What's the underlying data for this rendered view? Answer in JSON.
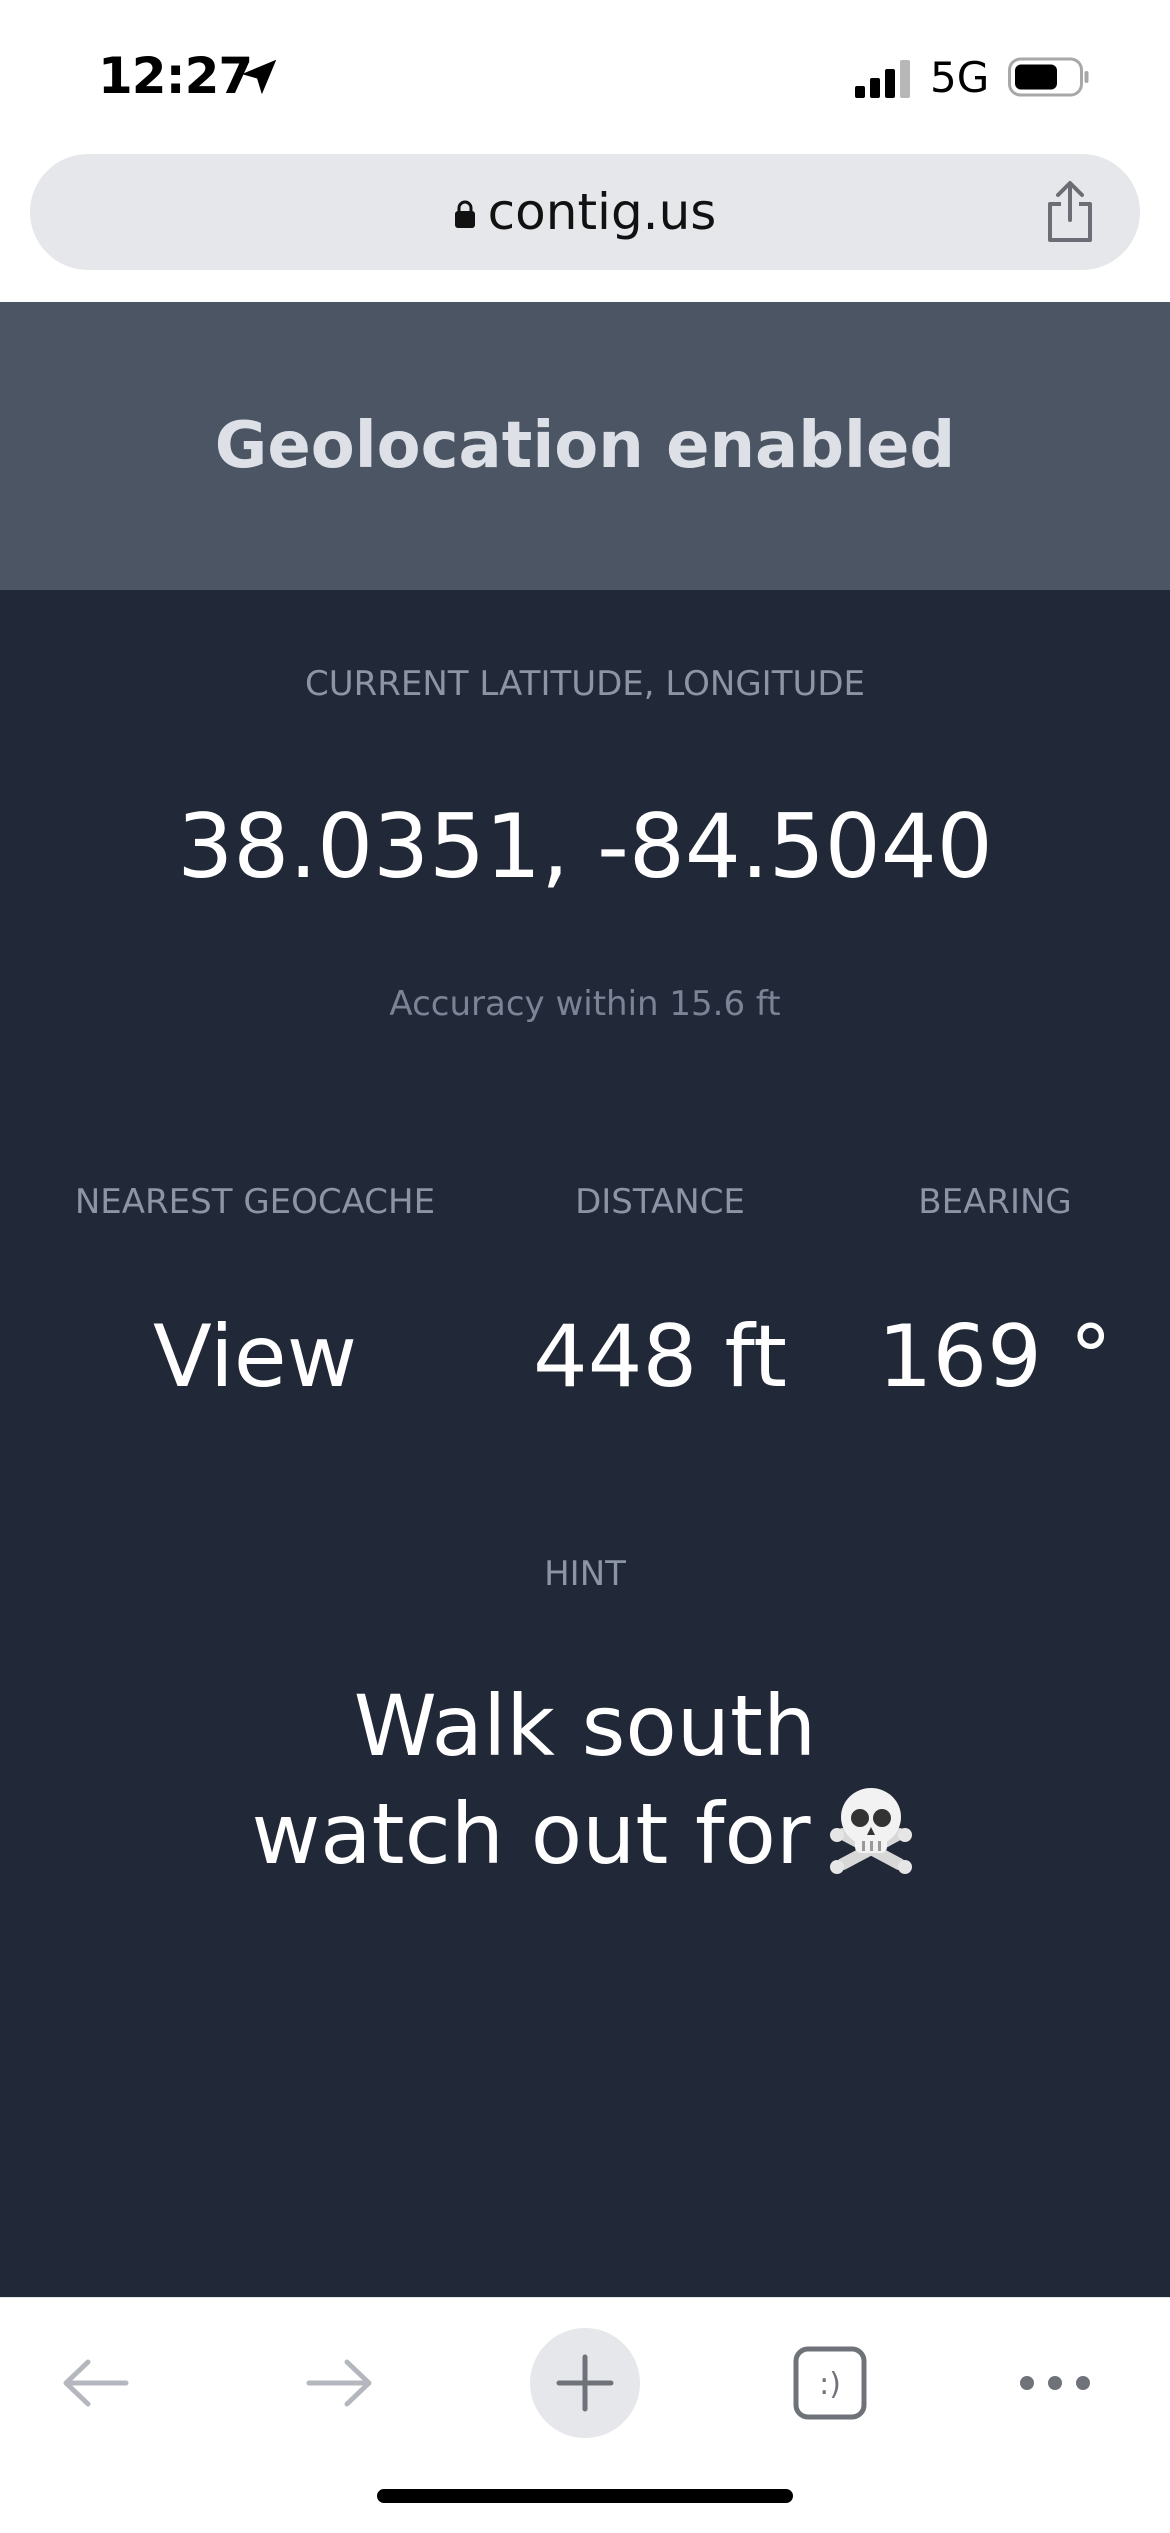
{
  "status_bar": {
    "time": "12:27",
    "network": "5G"
  },
  "browser": {
    "url": "contig.us"
  },
  "banner": {
    "text": "Geolocation enabled"
  },
  "location": {
    "label": "CURRENT LATITUDE, LONGITUDE",
    "coordinates": "38.0351, -84.5040",
    "accuracy": "Accuracy within 15.6 ft"
  },
  "stats": [
    {
      "label": "NEAREST GEOCACHE",
      "value": "View"
    },
    {
      "label": "DISTANCE",
      "value": "448 ft"
    },
    {
      "label": "BEARING",
      "value": "169 °"
    }
  ],
  "hint": {
    "label": "HINT",
    "line1": "Walk south",
    "line2": "watch out for"
  },
  "toolbar": {
    "tabs_glyph": ":)"
  },
  "colors": {
    "page_background": "#212837",
    "banner_background": "#4b5563",
    "label_gray": "#8c95a6"
  },
  "icons": {
    "location_arrow": "location-arrow-icon",
    "signal": "signal-icon",
    "battery": "battery-icon",
    "lock": "lock-icon",
    "share": "share-icon",
    "back": "back-arrow-icon",
    "forward": "forward-arrow-icon",
    "new_tab": "plus-icon",
    "tabs": "tabs-icon",
    "menu": "more-icon",
    "skull": "skull-crossbones-icon"
  }
}
